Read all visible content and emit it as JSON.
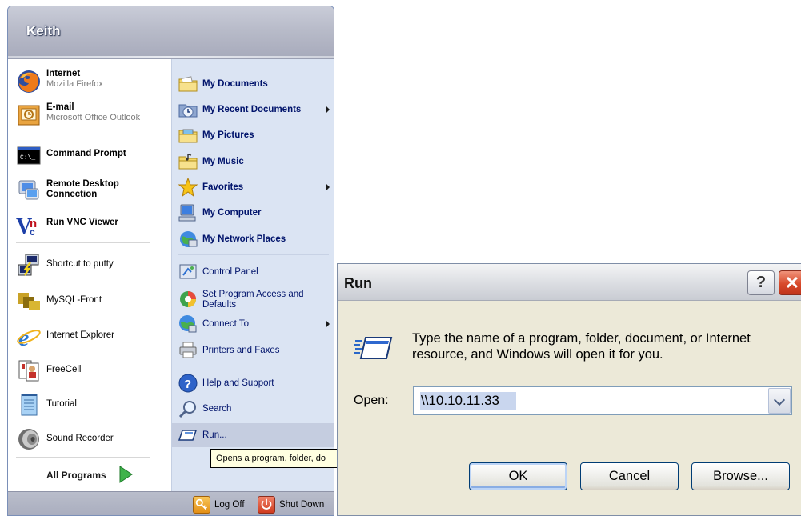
{
  "start_menu": {
    "username": "Keith",
    "pinned": [
      {
        "title": "Internet",
        "subtitle": "Mozilla Firefox",
        "icon": "firefox-icon"
      },
      {
        "title": "E-mail",
        "subtitle": "Microsoft Office Outlook",
        "icon": "outlook-icon"
      }
    ],
    "recent": [
      {
        "label": "Command Prompt",
        "bold": true,
        "icon": "command-prompt-icon"
      },
      {
        "label": "Remote Desktop Connection",
        "bold": true,
        "icon": "remote-desktop-icon"
      },
      {
        "label": "Run VNC Viewer",
        "bold": true,
        "icon": "vnc-icon"
      },
      {
        "label": "Shortcut to putty",
        "bold": false,
        "icon": "putty-icon"
      },
      {
        "label": "MySQL-Front",
        "bold": false,
        "icon": "mysql-front-icon"
      },
      {
        "label": "Internet Explorer",
        "bold": false,
        "icon": "internet-explorer-icon"
      },
      {
        "label": "FreeCell",
        "bold": false,
        "icon": "freecell-icon"
      },
      {
        "label": "Tutorial",
        "bold": false,
        "icon": "notepad-icon"
      },
      {
        "label": "Sound Recorder",
        "bold": false,
        "icon": "speaker-icon"
      }
    ],
    "all_programs": "All Programs",
    "places": [
      {
        "label": "My Documents",
        "icon": "folder-icon"
      },
      {
        "label": "My Recent Documents",
        "icon": "recent-documents-icon",
        "submenu": true
      },
      {
        "label": "My Pictures",
        "icon": "pictures-folder-icon"
      },
      {
        "label": "My Music",
        "icon": "music-folder-icon"
      },
      {
        "label": "Favorites",
        "icon": "star-icon",
        "submenu": true
      },
      {
        "label": "My Computer",
        "icon": "computer-icon"
      },
      {
        "label": "My Network Places",
        "icon": "network-icon"
      }
    ],
    "system": [
      {
        "label": "Control Panel",
        "icon": "control-panel-icon"
      },
      {
        "label": "Set Program Access and Defaults",
        "icon": "program-access-icon"
      },
      {
        "label": "Connect To",
        "icon": "connect-to-icon",
        "submenu": true
      },
      {
        "label": "Printers and Faxes",
        "icon": "printer-icon"
      }
    ],
    "help": [
      {
        "label": "Help and Support",
        "icon": "help-icon"
      },
      {
        "label": "Search",
        "icon": "search-icon"
      },
      {
        "label": "Run...",
        "icon": "run-icon"
      }
    ],
    "tooltip": "Opens a program, folder, do",
    "log_off": "Log Off",
    "shut_down": "Shut Down"
  },
  "run_dialog": {
    "title": "Run",
    "description": "Type the name of a program, folder, document, or Internet resource, and Windows will open it for you.",
    "open_label": "Open:",
    "open_value": "\\\\10.10.11.33",
    "ok": "OK",
    "cancel": "Cancel",
    "browse": "Browse..."
  }
}
